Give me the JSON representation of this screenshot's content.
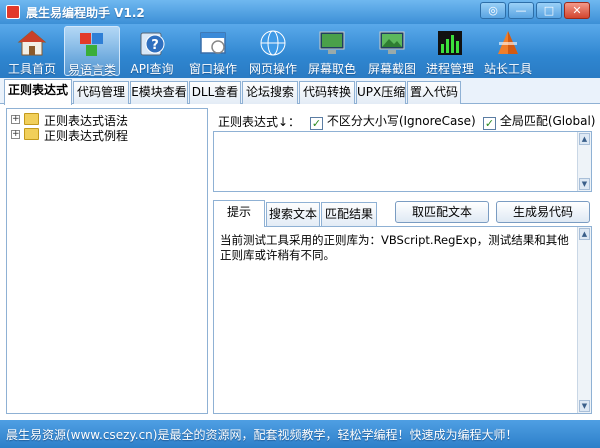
{
  "window": {
    "title": "晨生易编程助手 V1.2",
    "controls": [
      "◎",
      "—",
      "□",
      "✕"
    ]
  },
  "toolbar": {
    "items": [
      {
        "label": "工具首页",
        "icon": "home-icon"
      },
      {
        "label": "易语言类",
        "icon": "blocks-icon",
        "active": true
      },
      {
        "label": "API查询",
        "icon": "help-icon"
      },
      {
        "label": "窗口操作",
        "icon": "window-icon"
      },
      {
        "label": "网页操作",
        "icon": "globe-icon"
      },
      {
        "label": "屏幕取色",
        "icon": "monitor-icon"
      },
      {
        "label": "屏幕截图",
        "icon": "screenshot-icon"
      },
      {
        "label": "进程管理",
        "icon": "chart-icon"
      },
      {
        "label": "站长工具",
        "icon": "cone-icon"
      }
    ]
  },
  "tabs": [
    "正则表达式",
    "代码管理",
    "E模块查看",
    "DLL查看",
    "论坛搜索",
    "代码转换",
    "UPX压缩",
    "置入代码"
  ],
  "tree": {
    "items": [
      {
        "toggle": "+",
        "label": "正则表达式语法"
      },
      {
        "toggle": "+",
        "label": "正则表达式例程"
      }
    ]
  },
  "regex": {
    "label": "正则表达式↓：",
    "input_value": "",
    "ignore_case": {
      "label": "不区分大小写(IgnoreCase)",
      "checked": true
    },
    "global": {
      "label": "全局匹配(Global)",
      "checked": true
    }
  },
  "result_tabs": [
    "提示",
    "搜索文本",
    "匹配结果"
  ],
  "buttons": {
    "match": "取匹配文本",
    "generate": "生成易代码"
  },
  "tip": {
    "text": "当前测试工具采用的正则库为：VBScript.RegExp，测试结果和其他正则库或许稍有不同。"
  },
  "status": {
    "text": "晨生易资源(www.csezy.cn)是最全的资源网，配套视频教学，轻松学编程！快速成为编程大师！"
  }
}
